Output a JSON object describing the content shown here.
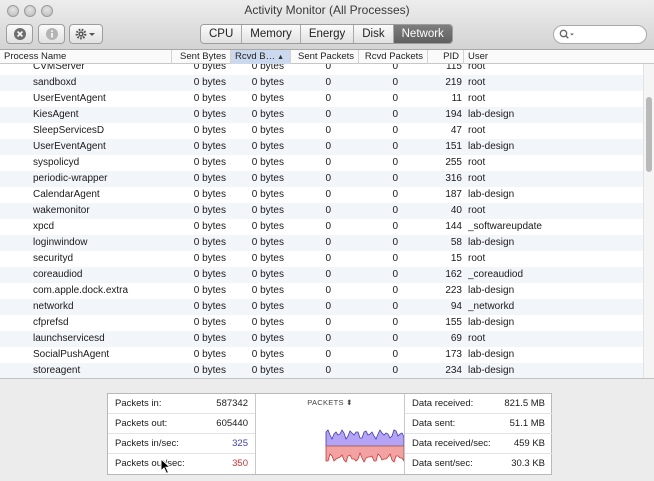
{
  "window": {
    "title": "Activity Monitor (All Processes)"
  },
  "toolbar": {
    "buttons": [
      {
        "name": "stop-process-button",
        "icon": "stop-icon"
      },
      {
        "name": "inspect-process-button",
        "icon": "info-icon"
      },
      {
        "name": "action-menu-button",
        "icon": "gear-icon"
      }
    ],
    "tabs": [
      "CPU",
      "Memory",
      "Energy",
      "Disk",
      "Network"
    ],
    "active_tab": "Network",
    "search": {
      "value": "",
      "placeholder": ""
    }
  },
  "table": {
    "columns": [
      "Process Name",
      "Sent Bytes",
      "Rcvd B…",
      "Sent Packets",
      "Rcvd Packets",
      "PID",
      "User"
    ],
    "sorted_column": "Rcvd B…",
    "rows": [
      [
        "CVMServer",
        "0 bytes",
        "0 bytes",
        "0",
        "0",
        "115",
        "root"
      ],
      [
        "sandboxd",
        "0 bytes",
        "0 bytes",
        "0",
        "0",
        "219",
        "root"
      ],
      [
        "UserEventAgent",
        "0 bytes",
        "0 bytes",
        "0",
        "0",
        "11",
        "root"
      ],
      [
        "KiesAgent",
        "0 bytes",
        "0 bytes",
        "0",
        "0",
        "194",
        "lab-design"
      ],
      [
        "SleepServicesD",
        "0 bytes",
        "0 bytes",
        "0",
        "0",
        "47",
        "root"
      ],
      [
        "UserEventAgent",
        "0 bytes",
        "0 bytes",
        "0",
        "0",
        "151",
        "lab-design"
      ],
      [
        "syspolicyd",
        "0 bytes",
        "0 bytes",
        "0",
        "0",
        "255",
        "root"
      ],
      [
        "periodic-wrapper",
        "0 bytes",
        "0 bytes",
        "0",
        "0",
        "316",
        "root"
      ],
      [
        "CalendarAgent",
        "0 bytes",
        "0 bytes",
        "0",
        "0",
        "187",
        "lab-design"
      ],
      [
        "wakemonitor",
        "0 bytes",
        "0 bytes",
        "0",
        "0",
        "40",
        "root"
      ],
      [
        "xpcd",
        "0 bytes",
        "0 bytes",
        "0",
        "0",
        "144",
        "_softwareupdate"
      ],
      [
        "loginwindow",
        "0 bytes",
        "0 bytes",
        "0",
        "0",
        "58",
        "lab-design"
      ],
      [
        "securityd",
        "0 bytes",
        "0 bytes",
        "0",
        "0",
        "15",
        "root"
      ],
      [
        "coreaudiod",
        "0 bytes",
        "0 bytes",
        "0",
        "0",
        "162",
        "_coreaudiod"
      ],
      [
        "com.apple.dock.extra",
        "0 bytes",
        "0 bytes",
        "0",
        "0",
        "223",
        "lab-design"
      ],
      [
        "networkd",
        "0 bytes",
        "0 bytes",
        "0",
        "0",
        "94",
        "_networkd"
      ],
      [
        "cfprefsd",
        "0 bytes",
        "0 bytes",
        "0",
        "0",
        "155",
        "lab-design"
      ],
      [
        "launchservicesd",
        "0 bytes",
        "0 bytes",
        "0",
        "0",
        "69",
        "root"
      ],
      [
        "SocialPushAgent",
        "0 bytes",
        "0 bytes",
        "0",
        "0",
        "173",
        "lab-design"
      ],
      [
        "storeagent",
        "0 bytes",
        "0 bytes",
        "0",
        "0",
        "234",
        "lab-design"
      ]
    ]
  },
  "summary": {
    "left": [
      {
        "label": "Packets in:",
        "value": "587342"
      },
      {
        "label": "Packets out:",
        "value": "605440"
      },
      {
        "label": "Packets in/sec:",
        "value": "325"
      },
      {
        "label": "Packets out/sec:",
        "value": "350"
      }
    ],
    "graph_title": "PACKETS",
    "graph_sort_glyph": "⬍",
    "right": [
      {
        "label": "Data received:",
        "value": "821.5 MB"
      },
      {
        "label": "Data sent:",
        "value": "51.1 MB"
      },
      {
        "label": "Data received/sec:",
        "value": "459 KB"
      },
      {
        "label": "Data sent/sec:",
        "value": "30.3 KB"
      }
    ],
    "colors": {
      "in": "#3d3dbd",
      "out": "#d63333",
      "in_fill": "#b5a3f5",
      "out_fill": "#f3a2a2"
    }
  }
}
